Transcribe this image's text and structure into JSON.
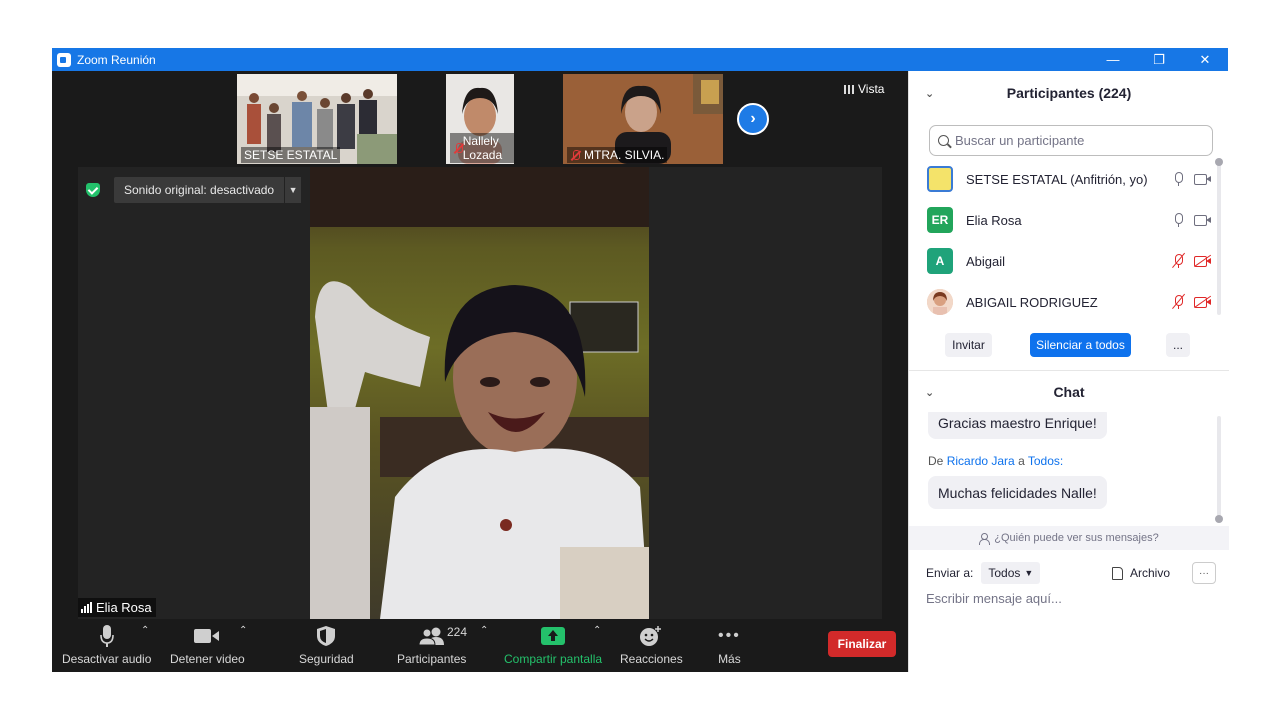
{
  "window": {
    "title": "Zoom Reunión",
    "controls": [
      "—",
      "❐",
      "✕"
    ]
  },
  "gallery": {
    "thumbnails": [
      {
        "name": "SETSE ESTATAL",
        "muted": false
      },
      {
        "name": "Nallely Lozada",
        "muted": true
      },
      {
        "name": "MTRA. SILVIA.",
        "muted": true
      }
    ],
    "next_arrow": "›",
    "view_label": "Vista"
  },
  "stage": {
    "original_sound_label": "Sonido original: desactivado",
    "speaker_name": "Elia Rosa"
  },
  "toolbar": {
    "audio_label": "Desactivar audio",
    "video_label": "Detener video",
    "security_label": "Seguridad",
    "participants_label": "Participantes",
    "participants_count": "224",
    "share_label": "Compartir pantalla",
    "reactions_label": "Reacciones",
    "more_label": "Más",
    "end_label": "Finalizar"
  },
  "participants_panel": {
    "title": "Participantes (224)",
    "search_placeholder": "Buscar un participante",
    "participants": [
      {
        "name": "SETSE ESTATAL (Anfitrión, yo)",
        "initials": "",
        "avatar_color": "#f4e36a",
        "muted": false
      },
      {
        "name": "Elia Rosa",
        "initials": "ER",
        "avatar_color": "#22a55b",
        "muted": false
      },
      {
        "name": "Abigail",
        "initials": "A",
        "avatar_color": "#1fa37a",
        "muted": true
      },
      {
        "name": "ABIGAIL RODRIGUEZ",
        "initials": "",
        "avatar_color": "#e6b8a2",
        "muted": true
      }
    ],
    "invite_label": "Invitar",
    "mute_all_label": "Silenciar a todos",
    "more_label": "..."
  },
  "chat": {
    "title": "Chat",
    "messages": [
      {
        "text": "Gracias maestro Enrique!"
      },
      {
        "from_prefix": "De",
        "from": "Ricardo Jara",
        "to_prefix": "a",
        "to": "Todos:",
        "text": "Muchas felicidades Nalle!"
      }
    ],
    "who_can_see": "¿Quién puede ver sus mensajes?",
    "send_to_label": "Enviar a:",
    "send_to_value": "Todos",
    "file_label": "Archivo",
    "more_label": "···",
    "input_placeholder": "Escribir mensaje aquí..."
  }
}
